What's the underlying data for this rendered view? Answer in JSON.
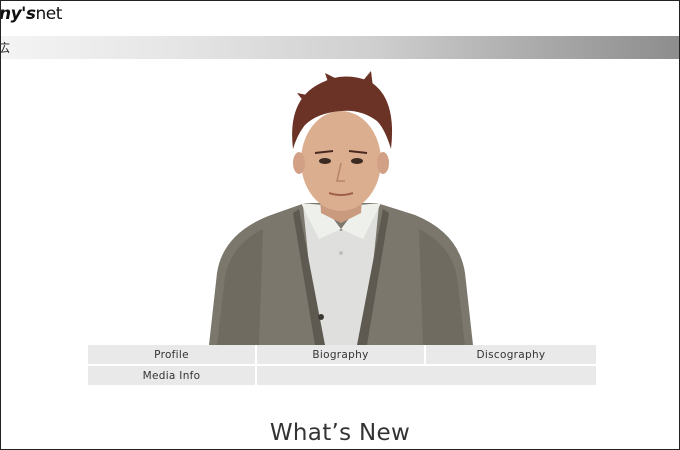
{
  "header": {
    "logo_text_bold": "ny's",
    "logo_text_net": "net"
  },
  "namebar": {
    "name_fragment": "広"
  },
  "menu": {
    "items": [
      {
        "label": "Profile"
      },
      {
        "label": "Biography"
      },
      {
        "label": "Discography"
      },
      {
        "label": "Media Info"
      },
      {
        "label": ""
      }
    ]
  },
  "main": {
    "section_title": "What’s New"
  },
  "colors": {
    "menu_bg": "#e9e9e9",
    "text": "#333333",
    "namebar_gradient_end": "#8d8d8d"
  }
}
